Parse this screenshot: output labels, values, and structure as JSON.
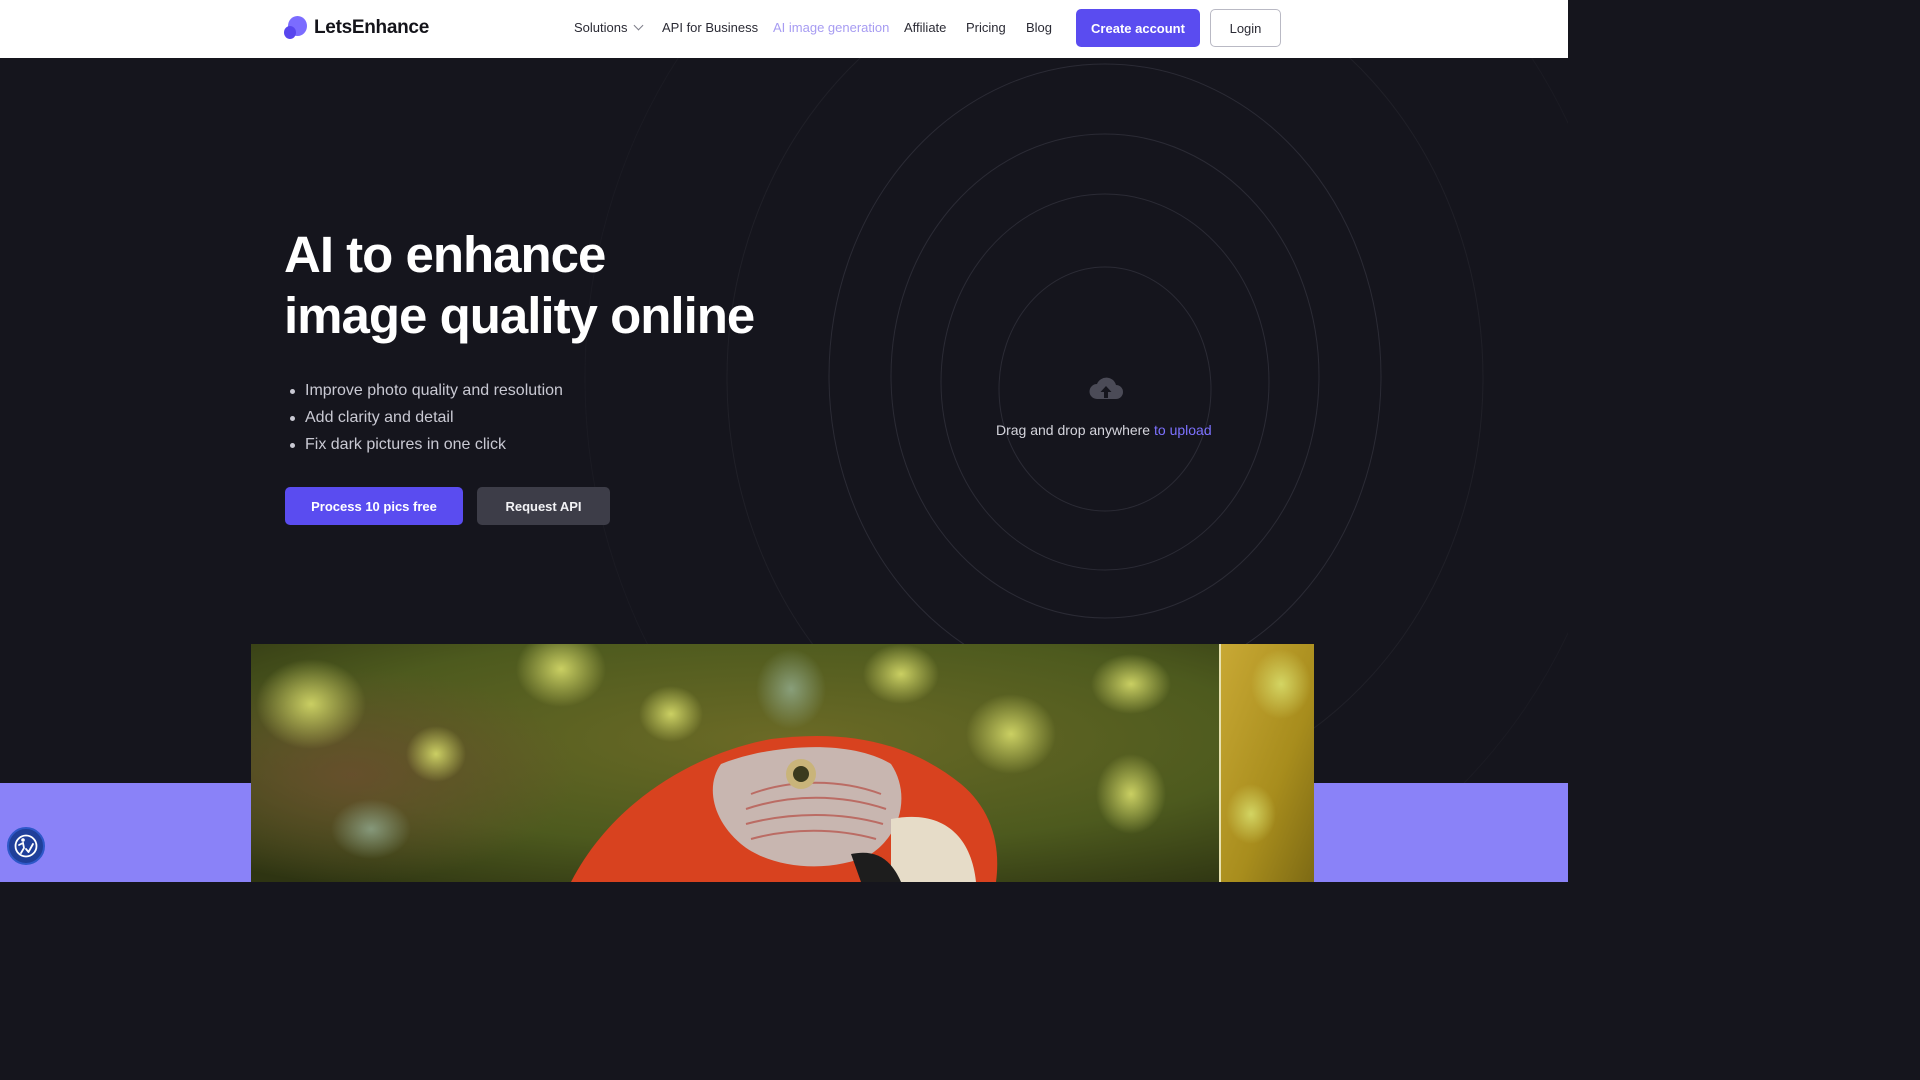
{
  "brand": {
    "name": "LetsEnhance"
  },
  "nav": {
    "solutions": "Solutions",
    "api_business": "API for Business",
    "ai_generation": "AI image generation",
    "affiliate": "Affiliate",
    "pricing": "Pricing",
    "blog": "Blog",
    "create_account": "Create account",
    "login": "Login"
  },
  "hero": {
    "headline_line1": "AI to enhance",
    "headline_line2": "image quality online",
    "bullets": [
      "Improve photo quality and resolution",
      "Add clarity and detail",
      "Fix dark pictures in one click"
    ],
    "primary_button": "Process 10 pics free",
    "secondary_button": "Request API"
  },
  "upload": {
    "text": "Drag and drop anywhere",
    "link": "to upload",
    "icon": "cloud-upload-icon"
  },
  "colors": {
    "accent": "#5a4cf0",
    "active_link": "#a79cf2",
    "hero_bg": "#15151d",
    "band": "#8a82f8"
  },
  "accessibility": {
    "icon": "accessibility-icon"
  }
}
